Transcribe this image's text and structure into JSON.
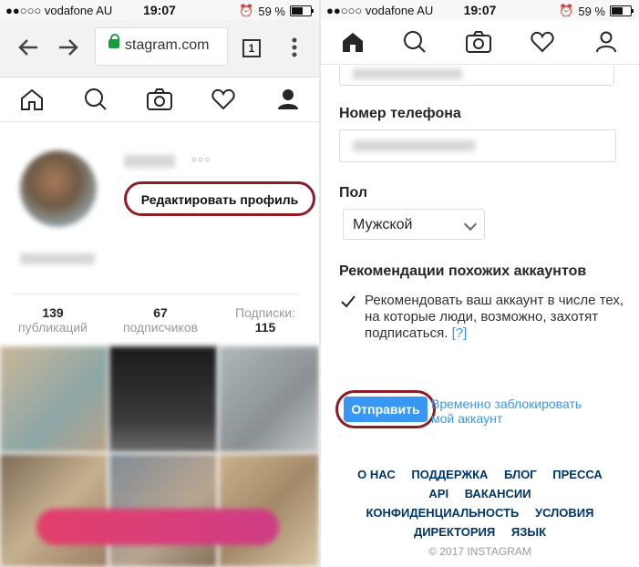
{
  "status": {
    "carrier": "●●○○○ vodafone AU",
    "time": "19:07",
    "battery": "59 %",
    "battery_level": 0.59
  },
  "left": {
    "url": "stagram.com",
    "tab_count": "1",
    "edit_profile": "Редактировать профиль",
    "more": "○○○",
    "stats": [
      {
        "value": "139",
        "label": "публикаций"
      },
      {
        "value": "67",
        "label": "подписчиков"
      },
      {
        "value": "115",
        "label": "Подписки:"
      }
    ]
  },
  "right": {
    "phone_label": "Номер телефона",
    "gender_label": "Пол",
    "gender_value": "Мужской",
    "recommend_label": "Рекомендации похожих аккаунтов",
    "recommend_text": "Рекомендовать ваш аккаунт в числе тех, на которые люди, возможно, захотят подписаться.",
    "recommend_help": "[?]",
    "submit": "Отправить",
    "temp_block_line1": "Временно заблокировать",
    "temp_block_line2": "мой аккаунт",
    "footer_row1": [
      "О НАС",
      "ПОДДЕРЖКА",
      "БЛОГ",
      "ПРЕССА"
    ],
    "footer_row2": [
      "API",
      "ВАКАНСИИ"
    ],
    "footer_row3": [
      "КОНФИДЕНЦИАЛЬНОСТЬ",
      "УСЛОВИЯ"
    ],
    "footer_row4": [
      "ДИРЕКТОРИЯ",
      "ЯЗЫК"
    ],
    "copyright": "© 2017 INSTAGRAM"
  },
  "colors": {
    "accent": "#3897f0",
    "highlight_ring": "#8b1e24",
    "footer_link": "#003569"
  }
}
